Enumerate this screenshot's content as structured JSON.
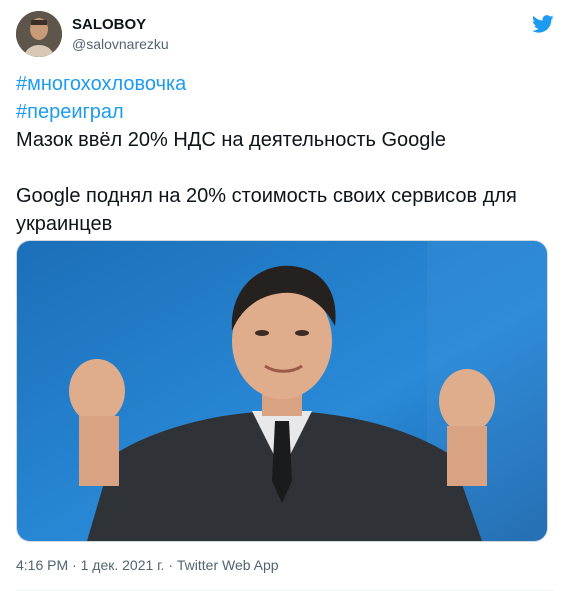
{
  "author": {
    "display_name": "SALOBOY",
    "handle": "@salovnarezku"
  },
  "tweet": {
    "hashtags": [
      "#многохохловочка",
      "#переиграл"
    ],
    "line1": "Мазок ввёл 20% НДС на деятельность Google",
    "line2": "Google поднял на 20% стоимость своих сервисов для",
    "line3": "украинцев"
  },
  "meta": {
    "time": "4:16 PM",
    "separator": " · ",
    "date": "1 дек. 2021 г.",
    "source": "Twitter Web App"
  },
  "icons": {
    "logo": "twitter-bird-icon"
  },
  "colors": {
    "accent": "#1d9bf0",
    "muted": "#536471"
  }
}
